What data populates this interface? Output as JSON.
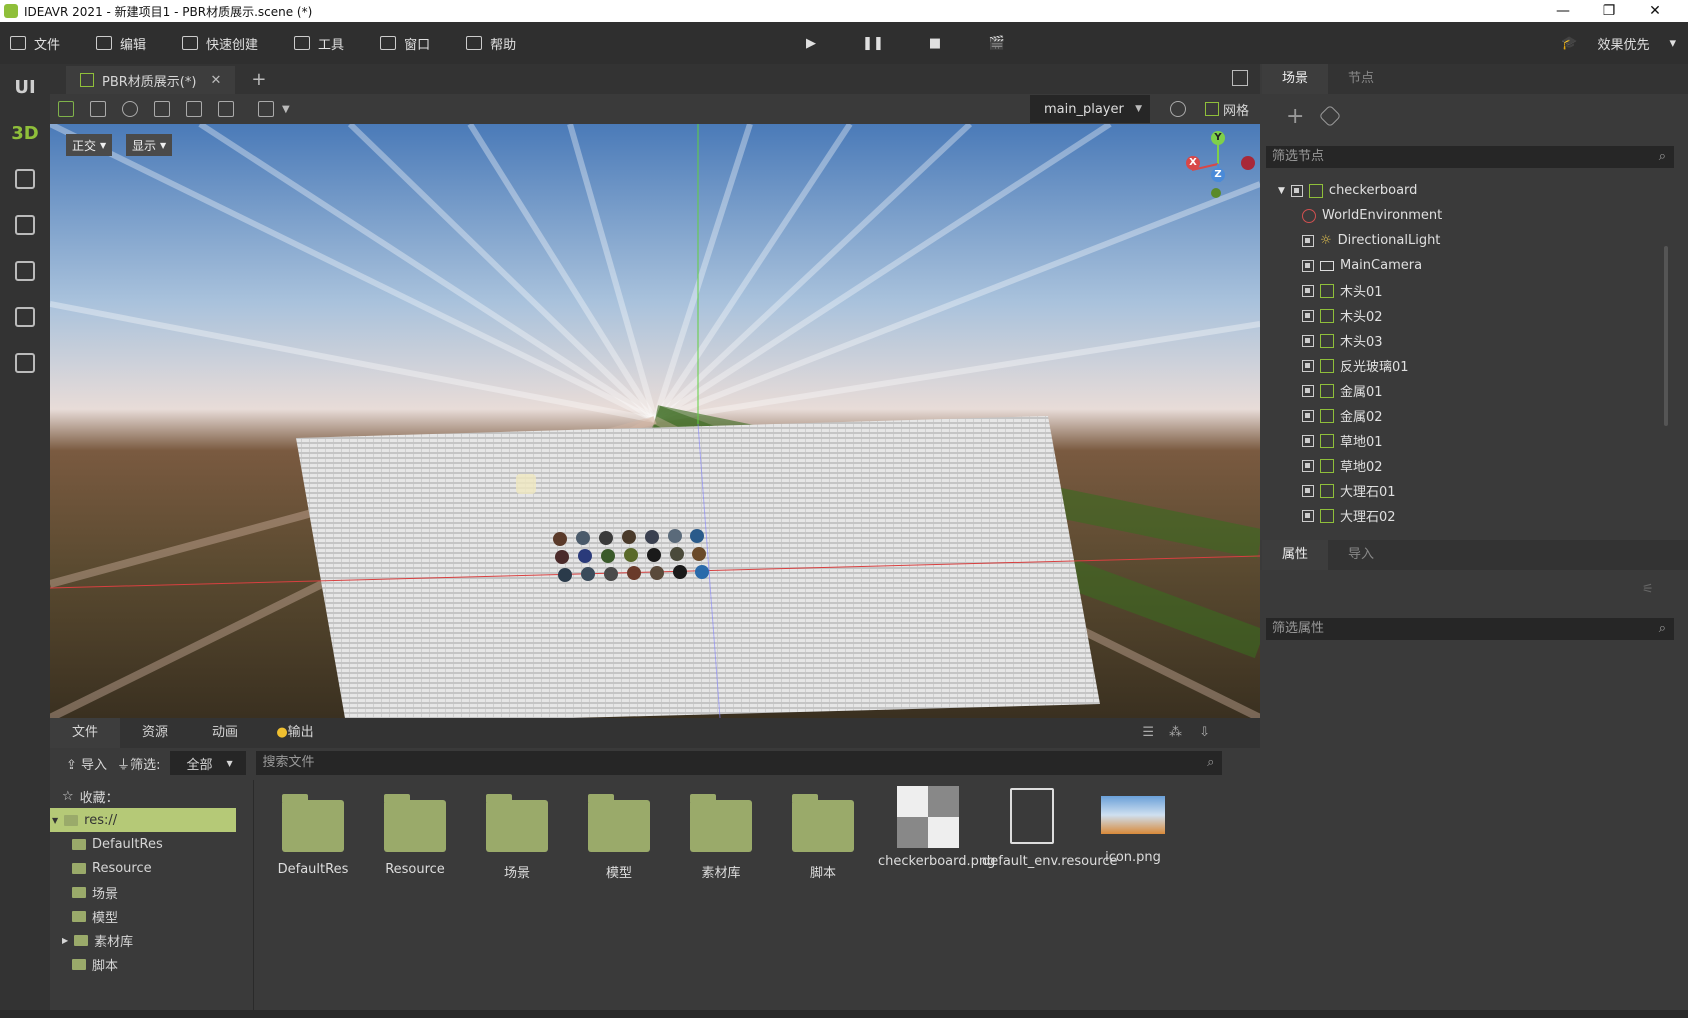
{
  "window": {
    "title": "IDEAVR 2021 - 新建项目1 - PBR材质展示.scene (*)",
    "minimize": "—",
    "restore": "❐",
    "close": "✕"
  },
  "menu": {
    "items": [
      "文件",
      "编辑",
      "快速创建",
      "工具",
      "窗口",
      "帮助"
    ],
    "right_label": "效果优先"
  },
  "playback": {
    "play": "▶",
    "pause": "❚❚",
    "stop": "■",
    "movie": "🎬"
  },
  "leftbar": {
    "ui_label": "UI",
    "3d_label": "3D"
  },
  "editor": {
    "tab_label": "PBR材质展示(*)",
    "tab_close": "✕",
    "tab_add": "+",
    "player_select": "main_player",
    "grid_label": "网格",
    "view_mode": "正交",
    "display_mode": "显示"
  },
  "gizmo": {
    "y": "Y",
    "x": "X",
    "z": "Z"
  },
  "scene_panel": {
    "tabs": [
      "场景",
      "节点"
    ],
    "filter_placeholder": "筛选节点",
    "nodes": [
      "checkerboard",
      "WorldEnvironment",
      "DirectionalLight",
      "MainCamera",
      "木头01",
      "木头02",
      "木头03",
      "反光玻璃01",
      "金属01",
      "金属02",
      "草地01",
      "草地02",
      "大理石01",
      "大理石02"
    ]
  },
  "props_panel": {
    "tabs": [
      "属性",
      "导入"
    ],
    "filter_placeholder": "筛选属性"
  },
  "bottom_panel": {
    "tabs": [
      "文件",
      "资源",
      "动画",
      "输出"
    ],
    "import_label": "导入",
    "filter_label": "筛选:",
    "filter_value": "全部",
    "search_placeholder": "搜索文件",
    "favorites_label": "收藏：",
    "tree": [
      "res://",
      "DefaultRes",
      "Resource",
      "场景",
      "模型",
      "素材库",
      "脚本"
    ],
    "files": [
      {
        "name": "DefaultRes"
      },
      {
        "name": "Resource"
      },
      {
        "name": "场景"
      },
      {
        "name": "模型"
      },
      {
        "name": "素材库"
      },
      {
        "name": "脚本"
      },
      {
        "name": "checkerboard.png"
      },
      {
        "name": "default_env.resource"
      },
      {
        "name": "icon.png"
      }
    ]
  }
}
